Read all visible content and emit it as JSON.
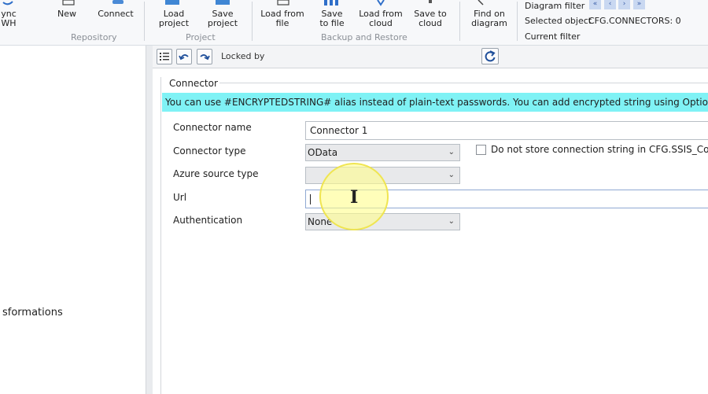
{
  "ribbon": {
    "buttons": {
      "sync_dwh": "ync\nWH",
      "new": "New",
      "connect": "Connect",
      "load_project": "Load\nproject",
      "save_project": "Save\nproject",
      "load_from_file": "Load from\nfile",
      "save_to_file": "Save\nto file",
      "load_from_cloud": "Load from\ncloud",
      "save_to_cloud": "Save to\ncloud",
      "find_on_diagram": "Find on\ndiagram"
    },
    "groups": {
      "repository": "Repository",
      "project": "Project",
      "backup_restore": "Backup and Restore"
    },
    "info": {
      "diagram_filter_label": "Diagram filter",
      "selected_object_label": "Selected object",
      "selected_object_value": "CFG.CONNECTORS: 0",
      "current_filter_label": "Current filter",
      "nav": [
        "«",
        "‹",
        "›",
        "»"
      ]
    }
  },
  "left_pane": {
    "item": "sformations"
  },
  "toolbar": {
    "locked_by_label": "Locked by",
    "locked_by_value": ""
  },
  "connector": {
    "legend": "Connector",
    "banner": "You can use #ENCRYPTEDSTRING# alias instead of plain-text passwords. You can add encrypted string using Options->Encrypted strings",
    "fields": {
      "name_label": "Connector name",
      "name_value": "Connector 1",
      "type_label": "Connector type",
      "type_value": "OData",
      "azure_label": "Azure source type",
      "azure_value": "",
      "url_label": "Url",
      "url_value": "",
      "auth_label": "Authentication",
      "auth_value": "None"
    },
    "checkbox_label": "Do not store connection string in CFG.SSIS_Configurations",
    "checkbox_checked": false
  },
  "colors": {
    "banner": "#7ff2f5",
    "cursor_highlight": "#fffd8c"
  }
}
